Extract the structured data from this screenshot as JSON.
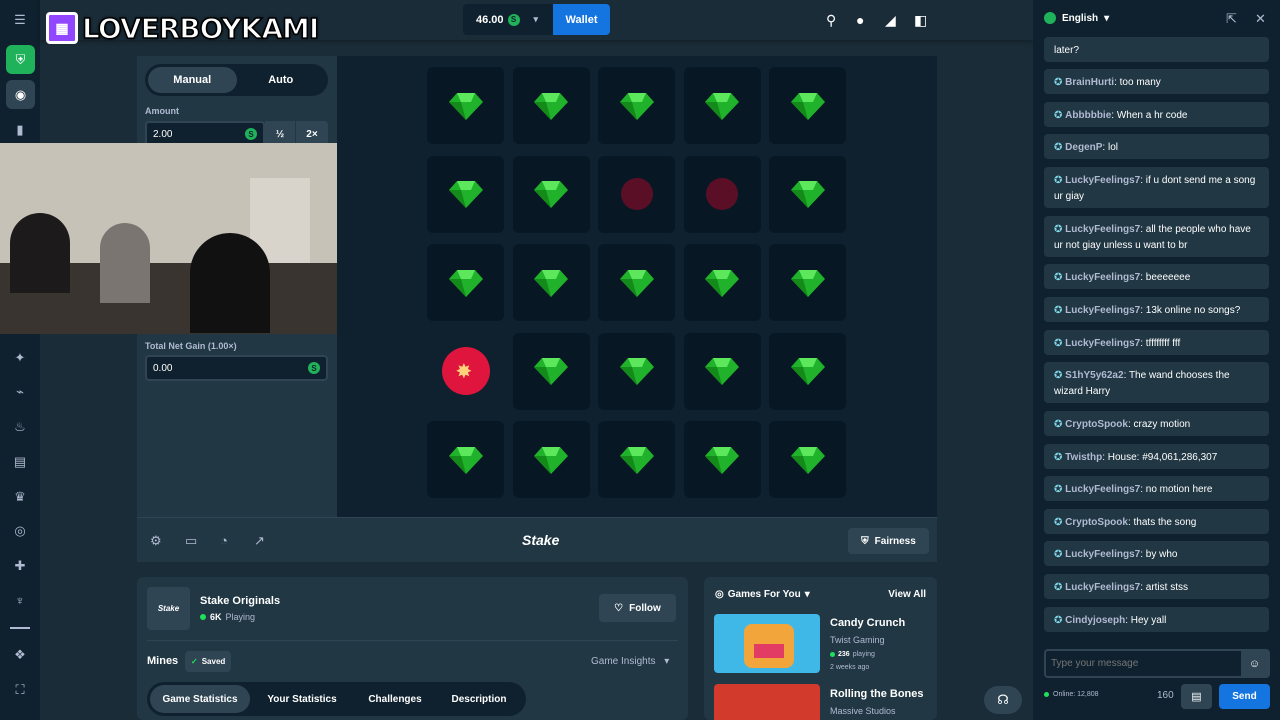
{
  "colors": {
    "accent": "#1475e1",
    "green": "#1fb25a",
    "bg": "#1a2c38",
    "dark": "#0f212e",
    "panel": "#213743",
    "gem": "#1fb22a",
    "mine": "#e0153d"
  },
  "logo_text": "LOVERBOYKAMI",
  "header": {
    "balance": "46.00",
    "wallet_label": "Wallet"
  },
  "bet_panel": {
    "tabs": [
      "Manual",
      "Auto"
    ],
    "amount_label": "Amount",
    "amount_value": "2.00",
    "half": "½",
    "double": "2×",
    "net_gain_label": "Total Net Gain (1.00×)",
    "net_gain_value": "0.00"
  },
  "board": {
    "rows": [
      [
        "gem",
        "gem",
        "gem",
        "gem",
        "gem"
      ],
      [
        "gem",
        "gem",
        "mine-dim",
        "mine-dim",
        "gem"
      ],
      [
        "gem",
        "gem",
        "gem",
        "gem",
        "gem"
      ],
      [
        "mine-hit",
        "gem",
        "gem",
        "gem",
        "gem"
      ],
      [
        "gem",
        "gem",
        "gem",
        "gem",
        "gem"
      ]
    ]
  },
  "footer": {
    "brand": "Stake",
    "fairness": "Fairness"
  },
  "publisher": {
    "name": "Stake Originals",
    "players": "6K",
    "playing": "Playing",
    "follow": "Follow",
    "logo": "Stake"
  },
  "game_info": {
    "title": "Mines",
    "saved": "Saved",
    "insights": "Game Insights",
    "tabs": [
      "Game Statistics",
      "Your Statistics",
      "Challenges",
      "Description"
    ]
  },
  "games_for_you": {
    "title": "Games For You",
    "view_all": "View All",
    "games": [
      {
        "name": "Candy Crunch",
        "studio": "Twist Gaming",
        "playing": "236",
        "playing_label": "playing",
        "age": "2 weeks ago"
      },
      {
        "name": "Rolling the Bones",
        "studio": "Massive Studios"
      }
    ]
  },
  "chat": {
    "language": "English",
    "messages": [
      {
        "user": "",
        "text": "later?"
      },
      {
        "user": "BrainHurti",
        "text": "too many"
      },
      {
        "user": "Abbbbbie",
        "text": "When a hr code"
      },
      {
        "user": "DegenP",
        "text": "lol"
      },
      {
        "user": "LuckyFeelings7",
        "text": "if u dont send me a song ur giay"
      },
      {
        "user": "LuckyFeelings7",
        "text": "all the people who have ur not giay unless u want to br"
      },
      {
        "user": "LuckyFeelings7",
        "text": "beeeeeee"
      },
      {
        "user": "LuckyFeelings7",
        "text": "13k online no songs?"
      },
      {
        "user": "LuckyFeelings7",
        "text": "tffffffff fff"
      },
      {
        "user": "S1hY5y62a2",
        "text": "The wand chooses the wizard Harry"
      },
      {
        "user": "CryptoSpook",
        "text": "crazy motion"
      },
      {
        "user": "Twisthp",
        "text": "House: #94,061,286,307"
      },
      {
        "user": "LuckyFeelings7",
        "text": "no motion here"
      },
      {
        "user": "CryptoSpook",
        "text": "thats the song"
      },
      {
        "user": "LuckyFeelings7",
        "text": "by who"
      },
      {
        "user": "LuckyFeelings7",
        "text": "artist stss"
      },
      {
        "user": "Cindyjoseph",
        "text": "Hey yall"
      }
    ],
    "placeholder": "Type your message",
    "online": "Online: 12,808",
    "count": "160",
    "send": "Send"
  }
}
